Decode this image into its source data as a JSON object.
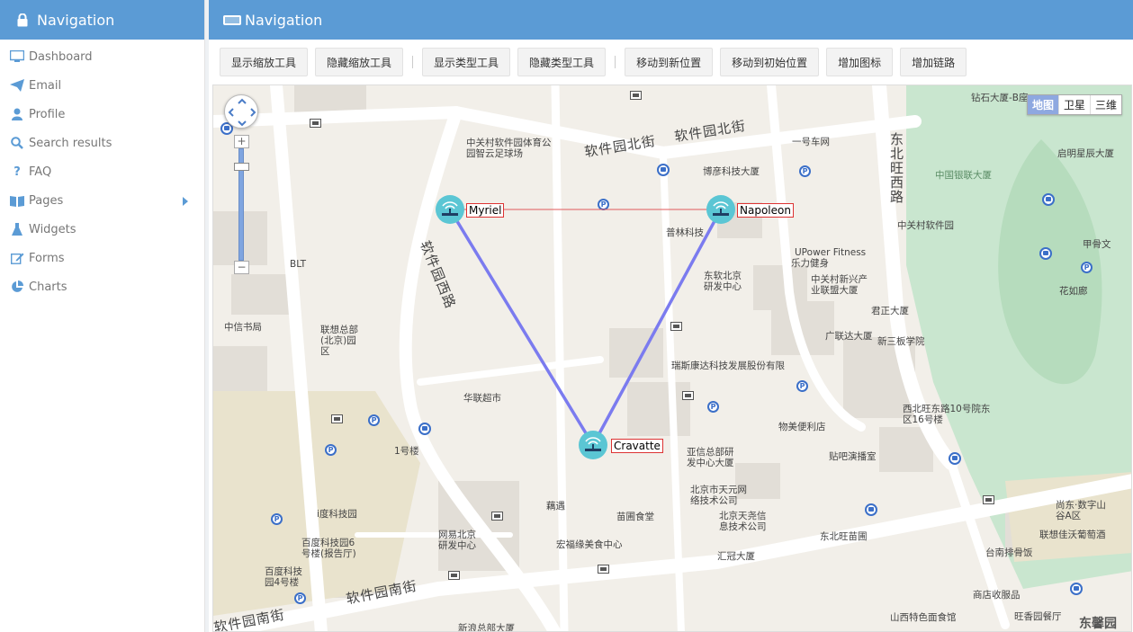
{
  "sidebar": {
    "title": "Navigation",
    "items": [
      {
        "label": "Dashboard",
        "icon": "monitor-icon"
      },
      {
        "label": "Email",
        "icon": "paper-plane-icon"
      },
      {
        "label": "Profile",
        "icon": "user-icon"
      },
      {
        "label": "Search results",
        "icon": "search-icon"
      },
      {
        "label": "FAQ",
        "icon": "question-icon"
      },
      {
        "label": "Pages",
        "icon": "book-icon",
        "has_children": true
      },
      {
        "label": "Widgets",
        "icon": "flask-icon"
      },
      {
        "label": "Forms",
        "icon": "edit-icon"
      },
      {
        "label": "Charts",
        "icon": "pie-chart-icon"
      }
    ]
  },
  "main": {
    "title": "Navigation"
  },
  "toolbar": {
    "show_zoom": "显示缩放工具",
    "hide_zoom": "隐藏缩放工具",
    "show_type": "显示类型工具",
    "hide_type": "隐藏类型工具",
    "move_new": "移动到新位置",
    "move_init": "移动到初始位置",
    "add_icon": "增加图标",
    "add_link": "增加链路"
  },
  "map": {
    "type_switch": {
      "map": "地图",
      "satellite": "卫星",
      "three_d": "三维"
    },
    "zoom_in": "+",
    "zoom_out": "−",
    "roads": {
      "north_1": "软件园北街",
      "north_2": "软件园北街",
      "west": "软件园西路",
      "south": "软件园南街",
      "south_2": "软件园南街",
      "east": "东北旺西路"
    },
    "pois": {
      "software_park": "中关村软件园体育公园智云足球场",
      "no1_garage": "一号车网",
      "bohui": "博彦科技大厦",
      "pulin": "普林科技",
      "upower": "UPower Fitness",
      "upower2": "乐力健身",
      "zgc_software": "中关村软件园",
      "zgc_xinxing": "中关村新兴产业联盟大厦",
      "dongruan": "东软北京研发中心",
      "junzheng": "君正大厦",
      "guanglian": "广联达大厦",
      "sanban": "新三板学院",
      "blt": "BLT",
      "citic_book": "中信书局",
      "lenovo": "联想总部(北京)园区",
      "huaxia": "华联超市",
      "ruisi": "瑞斯康达科技发展股份有限",
      "building1": "1号楼",
      "xierwang": "西北旺东路10号院东区16号楼",
      "wumei": "物美便利店",
      "tieba": "贴吧演播室",
      "yaxin": "亚信总部研发中心大厦",
      "tianyuan": "北京市天元网络技术公司",
      "ouyu": "藕遇",
      "miaopu": "苗圃食堂",
      "beijing_tianyao": "北京天尧信息技术公司",
      "hongfu": "宏福缘美食中心",
      "huiguan": "汇冠大厦",
      "dongbeiwang_park": "东北旺苗圃",
      "iaiduo": "i度科技园",
      "wangyi": "网易北京研发中心",
      "baidu6": "百度科技园6号楼(报告厅)",
      "baidu4": "百度科技园4号楼",
      "xinlang": "新浪总部大厦",
      "zuanshi": "钻石大厦-B座",
      "qiming": "启明星辰大厦",
      "cmb": "中国银联大厦",
      "jiazhiwen": "甲骨文",
      "huaru": "花如廊",
      "shangdong": "尚东·数字山谷A区",
      "lenovo_grape": "联想佳沃葡萄酒",
      "taiwan": "台南排骨饭",
      "shangdian": "商店收服品",
      "shansi": "山西特色面食馆",
      "wangxiang": "旺香园餐厅",
      "dongxin": "东馨园"
    },
    "nodes": [
      {
        "name": "Myriel"
      },
      {
        "name": "Napoleon"
      },
      {
        "name": "Cravatte"
      }
    ]
  },
  "colors": {
    "header_bg": "#5b9bd5",
    "link_main": "#7b7bef",
    "link_thin": "#e05a5a",
    "node_color": "#5bc6d4"
  }
}
